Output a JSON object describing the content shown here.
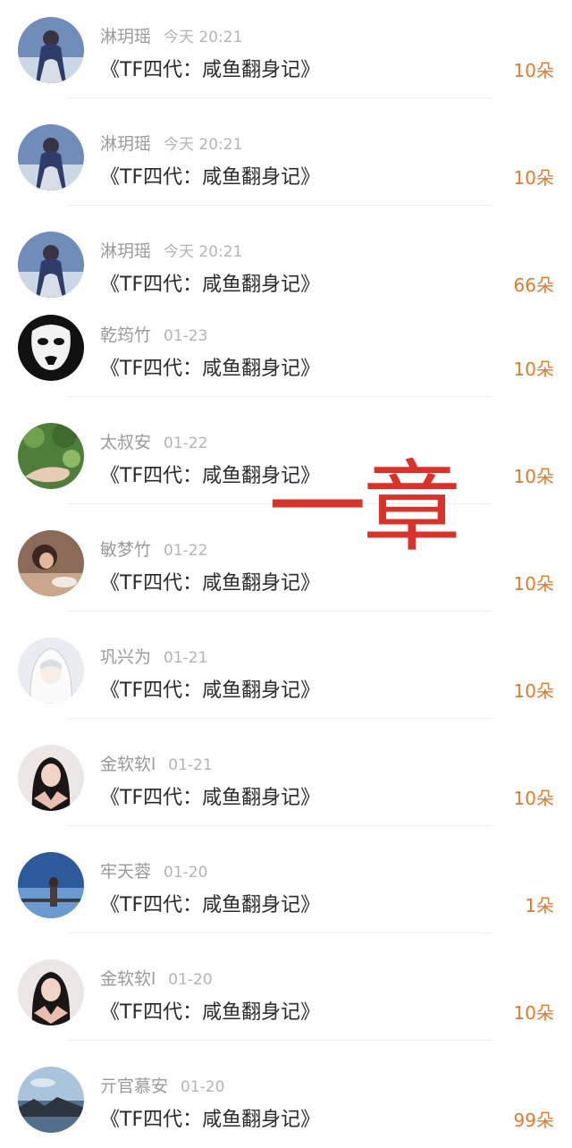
{
  "overlay": {
    "text": "一章"
  },
  "items": [
    {
      "name": "淋玥瑶",
      "time": "今天 20:21",
      "title": "《TF四代：咸鱼翻身记》",
      "amount": "10朵",
      "avatar": "girl-blue-dress-avatar"
    },
    {
      "name": "淋玥瑶",
      "time": "今天 20:21",
      "title": "《TF四代：咸鱼翻身记》",
      "amount": "10朵",
      "avatar": "girl-blue-dress-avatar"
    },
    {
      "name": "淋玥瑶",
      "time": "今天 20:21",
      "title": "《TF四代：咸鱼翻身记》",
      "amount": "66朵",
      "avatar": "girl-blue-dress-avatar"
    },
    {
      "name": "乾筠竹",
      "time": "01-23",
      "title": "《TF四代：咸鱼翻身记》",
      "amount": "10朵",
      "avatar": "white-mask-avatar"
    },
    {
      "name": "太叔安",
      "time": "01-22",
      "title": "《TF四代：咸鱼翻身记》",
      "amount": "10朵",
      "avatar": "green-leaves-hand-avatar"
    },
    {
      "name": "敏梦竹",
      "time": "01-22",
      "title": "《TF四代：咸鱼翻身记》",
      "amount": "10朵",
      "avatar": "girl-eating-avatar"
    },
    {
      "name": "巩兴为",
      "time": "01-21",
      "title": "《TF四代：咸鱼翻身记》",
      "amount": "10朵",
      "avatar": "white-hood-anime-avatar"
    },
    {
      "name": "金软软l",
      "time": "01-21",
      "title": "《TF四代：咸鱼翻身记》",
      "amount": "10朵",
      "avatar": "girl-heart-hands-avatar"
    },
    {
      "name": "牢天蓉",
      "time": "01-20",
      "title": "《TF四代：咸鱼翻身记》",
      "amount": "1朵",
      "avatar": "anime-sky-avatar"
    },
    {
      "name": "金软软l",
      "time": "01-20",
      "title": "《TF四代：咸鱼翻身记》",
      "amount": "10朵",
      "avatar": "girl-heart-hands-avatar"
    },
    {
      "name": "亓官慕安",
      "time": "01-20",
      "title": "《TF四代：咸鱼翻身记》",
      "amount": "99朵",
      "avatar": "sea-rocks-avatar"
    }
  ]
}
